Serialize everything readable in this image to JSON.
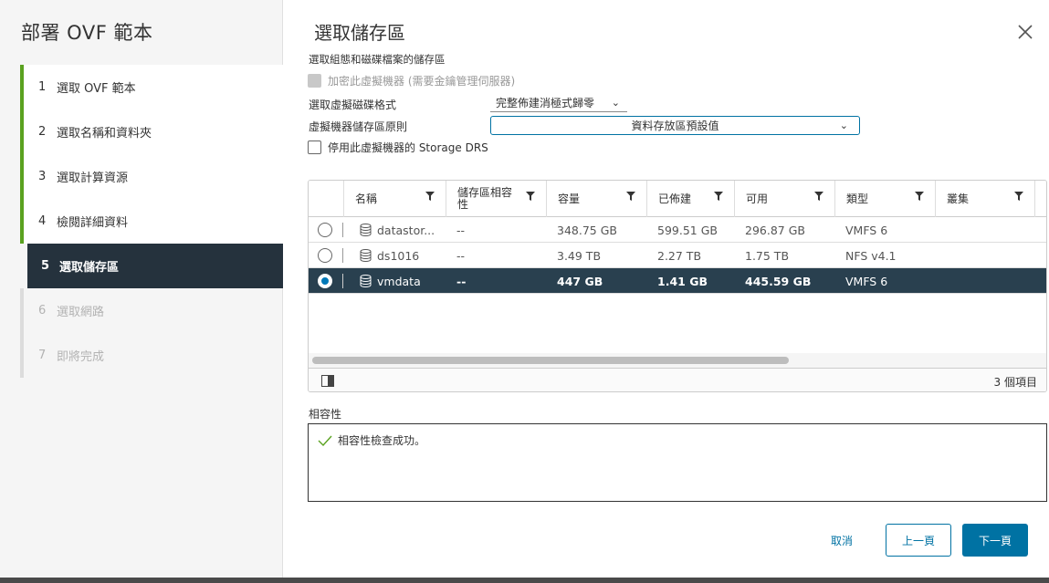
{
  "wizard": {
    "title": "部署 OVF 範本",
    "steps": [
      {
        "num": "1",
        "label": "選取 OVF 範本"
      },
      {
        "num": "2",
        "label": "選取名稱和資料夾"
      },
      {
        "num": "3",
        "label": "選取計算資源"
      },
      {
        "num": "4",
        "label": "檢閱詳細資料"
      },
      {
        "num": "5",
        "label": "選取儲存區"
      },
      {
        "num": "6",
        "label": "選取網路"
      },
      {
        "num": "7",
        "label": "即將完成"
      }
    ]
  },
  "main": {
    "title": "選取儲存區",
    "subtitle": "選取組態和磁碟檔案的儲存區",
    "encrypt_label": "加密此虛擬機器 (需要金鑰管理伺服器)",
    "disk_format_label": "選取虛擬磁碟格式",
    "disk_format_value": "完整佈建消極式歸零",
    "policy_label": "虛擬機器儲存區原則",
    "policy_value": "資料存放區預設值",
    "drs_label": "停用此虛擬機器的 Storage DRS"
  },
  "grid": {
    "columns": [
      "名稱",
      "儲存區相容性",
      "容量",
      "已佈建",
      "可用",
      "類型",
      "叢集"
    ],
    "rows": [
      {
        "name": "datastor...",
        "compat": "--",
        "capacity": "348.75 GB",
        "provisioned": "599.51 GB",
        "free": "296.87 GB",
        "type": "VMFS 6",
        "cluster": "",
        "selected": false
      },
      {
        "name": "ds1016",
        "compat": "--",
        "capacity": "3.49 TB",
        "provisioned": "2.27 TB",
        "free": "1.75 TB",
        "type": "NFS v4.1",
        "cluster": "",
        "selected": false
      },
      {
        "name": "vmdata",
        "compat": "--",
        "capacity": "447 GB",
        "provisioned": "1.41 GB",
        "free": "445.59 GB",
        "type": "VMFS 6",
        "cluster": "",
        "selected": true
      }
    ],
    "item_count": "3 個項目"
  },
  "compatibility": {
    "label": "相容性",
    "message": "相容性檢查成功。"
  },
  "footer": {
    "cancel": "取消",
    "back": "上一頁",
    "next": "下一頁"
  },
  "colors": {
    "accent": "#0072a3",
    "step_done": "#5aa220",
    "selected_row": "#29404f",
    "current_step": "#25323d"
  }
}
